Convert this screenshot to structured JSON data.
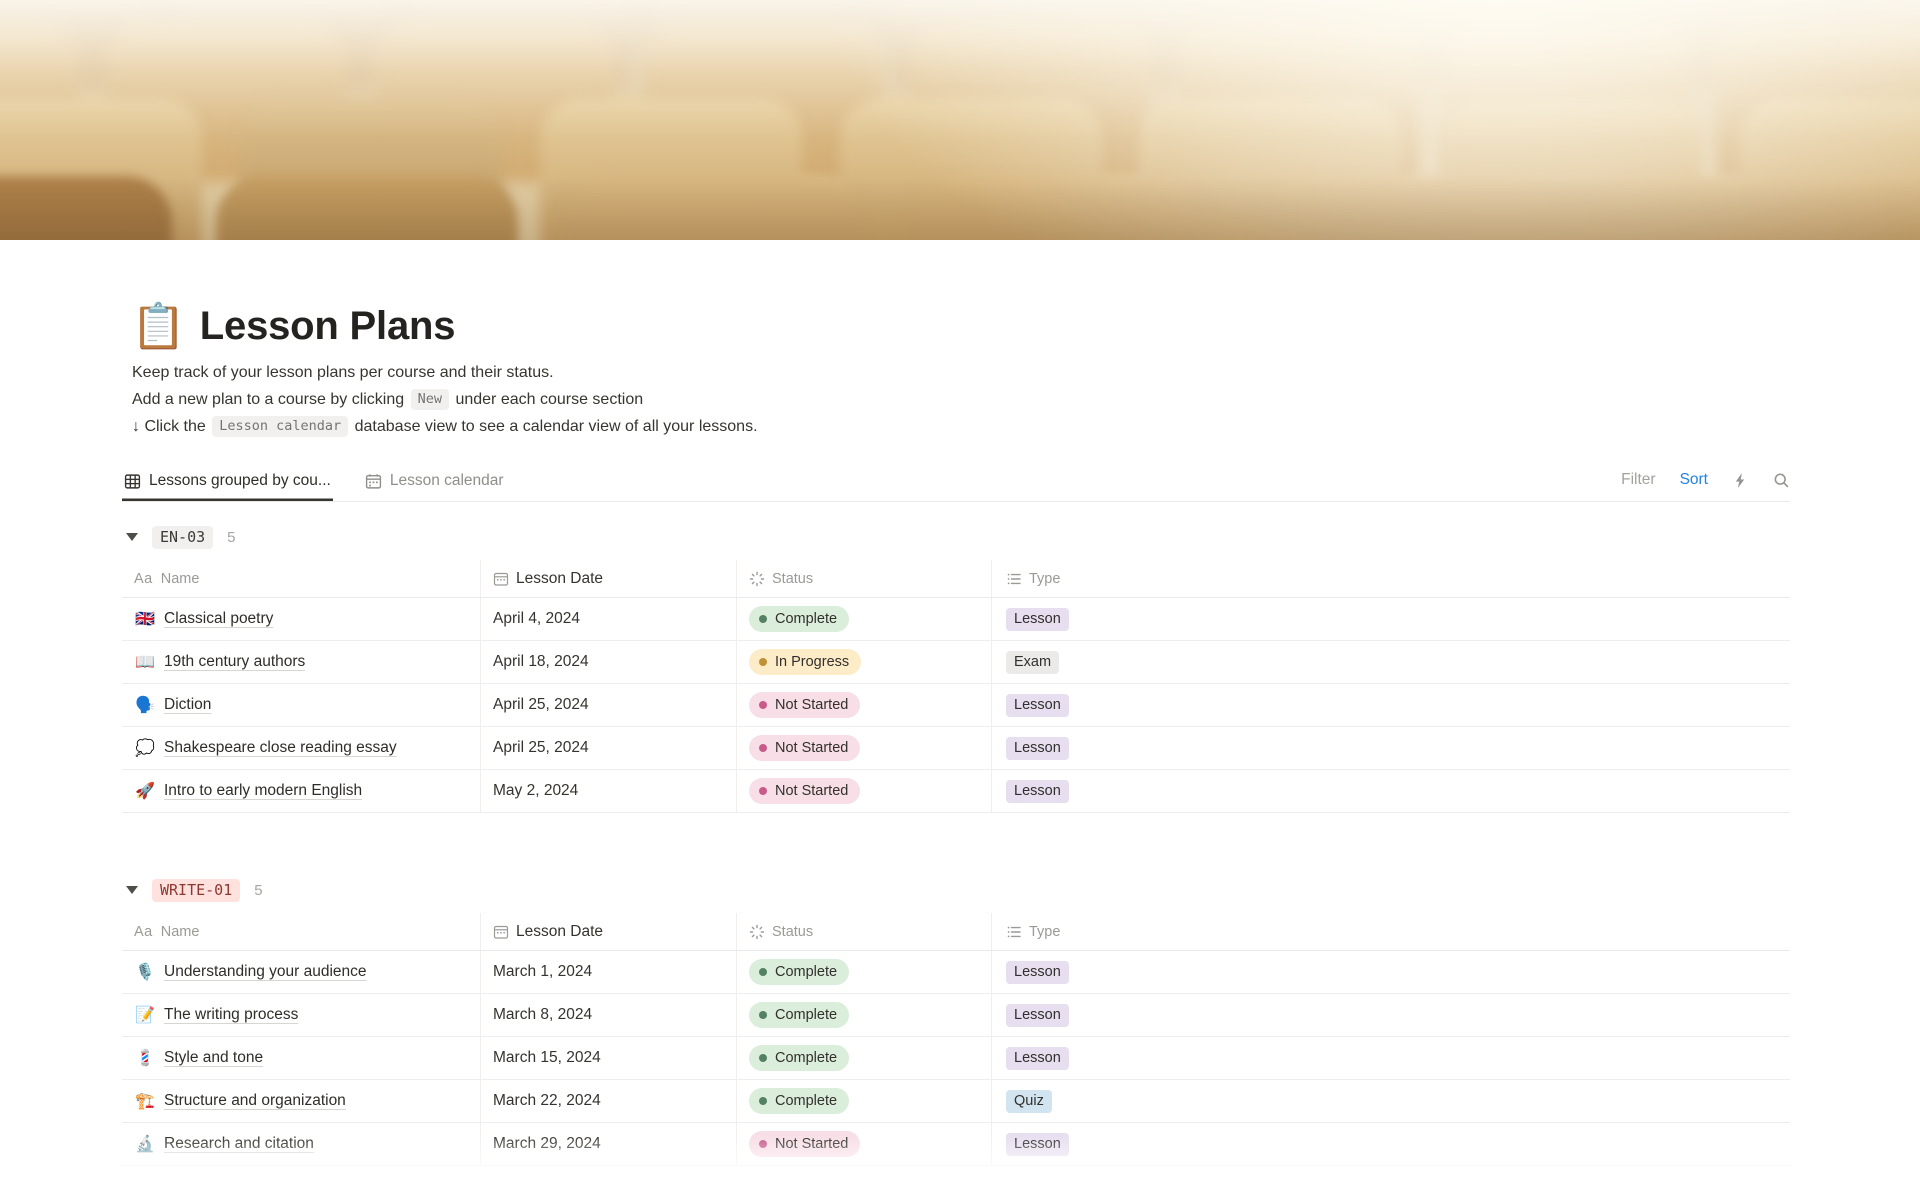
{
  "page": {
    "icon": "📋",
    "title": "Lesson Plans",
    "description": {
      "line1": "Keep track of your lesson plans per course and their status.",
      "line2_pre": "Add a new plan to a course by clicking",
      "line2_chip": "New",
      "line2_post": "under each course section",
      "line3_pre": "↓ Click the",
      "line3_chip": "Lesson calendar",
      "line3_post": "database view to see a calendar view of all your lessons."
    }
  },
  "tabs": [
    {
      "label": "Lessons grouped by cou...",
      "icon": "table-icon",
      "active": true
    },
    {
      "label": "Lesson calendar",
      "icon": "calendar-icon",
      "active": false
    }
  ],
  "toolbar": {
    "filter_label": "Filter",
    "sort_label": "Sort",
    "icons": [
      "lightning-icon",
      "search-icon"
    ]
  },
  "table": {
    "columns": [
      {
        "icon": "text-icon",
        "label": "Name"
      },
      {
        "icon": "calendar-icon",
        "label": "Lesson Date"
      },
      {
        "icon": "status-icon",
        "label": "Status"
      },
      {
        "icon": "list-icon",
        "label": "Type"
      }
    ],
    "groups": [
      {
        "name": "EN-03",
        "count": "5",
        "rows": [
          {
            "icon": "🇬🇧",
            "name": "Classical poetry",
            "date": "April 4, 2024",
            "status": "Complete",
            "type": "Lesson"
          },
          {
            "icon": "📖",
            "name": "19th century authors",
            "date": "April 18, 2024",
            "status": "In Progress",
            "type": "Exam"
          },
          {
            "icon": "🗣️",
            "name": "Diction",
            "date": "April 25, 2024",
            "status": "Not Started",
            "type": "Lesson"
          },
          {
            "icon": "💭",
            "name": "Shakespeare close reading essay",
            "date": "April 25, 2024",
            "status": "Not Started",
            "type": "Lesson"
          },
          {
            "icon": "🚀",
            "name": "Intro to early modern English",
            "date": "May 2, 2024",
            "status": "Not Started",
            "type": "Lesson"
          }
        ]
      },
      {
        "name": "WRITE-01",
        "count": "5",
        "rows": [
          {
            "icon": "🎙️",
            "name": "Understanding your audience",
            "date": "March 1, 2024",
            "status": "Complete",
            "type": "Lesson"
          },
          {
            "icon": "📝",
            "name": "The writing process",
            "date": "March 8, 2024",
            "status": "Complete",
            "type": "Lesson"
          },
          {
            "icon": "💈",
            "name": "Style and tone",
            "date": "March 15, 2024",
            "status": "Complete",
            "type": "Lesson"
          },
          {
            "icon": "🏗️",
            "name": "Structure and organization",
            "date": "March 22, 2024",
            "status": "Complete",
            "type": "Quiz"
          },
          {
            "icon": "🔬",
            "name": "Research and citation",
            "date": "March 29, 2024",
            "status": "Not Started",
            "type": "Lesson"
          }
        ]
      }
    ]
  },
  "colors": {
    "accent_blue": "#2383e2",
    "status_complete_bg": "#dbeddb",
    "status_complete_dot": "#548164",
    "status_inprogress_bg": "#fdecc8",
    "status_inprogress_dot": "#c19138",
    "status_notstarted_bg": "#f8dee7",
    "status_notstarted_dot": "#c75c8c",
    "type_lesson_bg": "#e7def0",
    "type_exam_bg": "#eceae9",
    "type_quiz_bg": "#d2e4f0",
    "group_en03_bg": "#f1f0ee",
    "group_write01_bg": "#ffe2dd",
    "group_write01_text": "#8f3731"
  }
}
